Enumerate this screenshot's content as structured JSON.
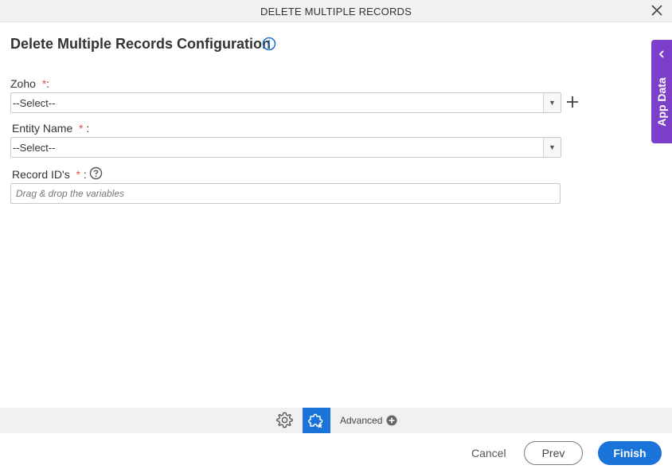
{
  "dialog": {
    "title": "DELETE MULTIPLE RECORDS",
    "heading": "Delete Multiple Records Configuration"
  },
  "form": {
    "zoho": {
      "label": "Zoho",
      "required_mark": "*",
      "suffix": ":",
      "value": "--Select--"
    },
    "entity_name": {
      "label": "Entity Name",
      "required_mark": "*",
      "suffix": ":",
      "value": "--Select--"
    },
    "record_ids": {
      "label": "Record ID's",
      "required_mark": "*",
      "suffix": ":",
      "placeholder": "Drag & drop the variables"
    }
  },
  "side_panel": {
    "label": "App Data"
  },
  "advanced_bar": {
    "label": "Advanced"
  },
  "footer": {
    "cancel_label": "Cancel",
    "prev_label": "Prev",
    "finish_label": "Finish"
  },
  "colors": {
    "accent": "#1a73d9",
    "side_panel": "#7b3fc9",
    "required": "#d9534f",
    "bar_background": "#f1f1f1"
  },
  "icons": [
    "close-icon",
    "info-icon",
    "add-icon",
    "help-icon",
    "chevron-left-icon",
    "gear-icon",
    "puzzle-icon",
    "plus-circle-icon"
  ]
}
